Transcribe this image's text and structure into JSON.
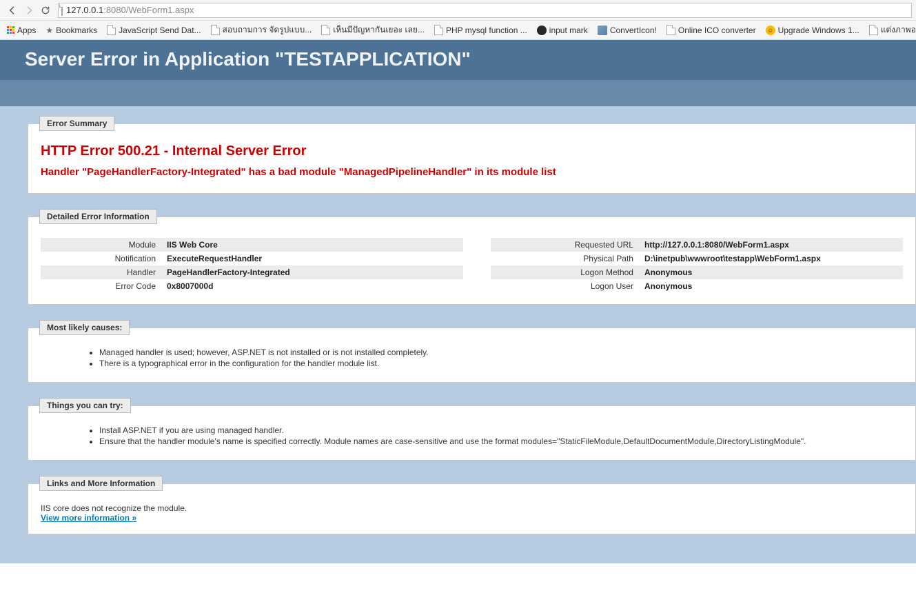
{
  "browser": {
    "url_host": "127.0.0.1",
    "url_rest": ":8080/WebForm1.aspx"
  },
  "bookmarks": {
    "apps": "Apps",
    "items": [
      {
        "label": "Bookmarks",
        "icon": "star"
      },
      {
        "label": "JavaScript Send Dat...",
        "icon": "page"
      },
      {
        "label": "สอบถามการ จัดรูปแบบ...",
        "icon": "page"
      },
      {
        "label": "เห็นมีปัญหากันเยอะ เลย...",
        "icon": "page"
      },
      {
        "label": "PHP mysql function ...",
        "icon": "page"
      },
      {
        "label": "input mark",
        "icon": "github"
      },
      {
        "label": "ConvertIcon!",
        "icon": "converticon"
      },
      {
        "label": "Online ICO converter",
        "icon": "page"
      },
      {
        "label": "Upgrade Windows 1...",
        "icon": "upgrade"
      },
      {
        "label": "แต่งภาพออน",
        "icon": "page"
      }
    ]
  },
  "header": {
    "title": "Server Error in Application \"TESTAPPLICATION\""
  },
  "summary": {
    "legend": "Error Summary",
    "title": "HTTP Error 500.21 - Internal Server Error",
    "subtitle": "Handler \"PageHandlerFactory-Integrated\" has a bad module \"ManagedPipelineHandler\" in its module list"
  },
  "detail": {
    "legend": "Detailed Error Information",
    "left_rows": [
      {
        "label": "Module",
        "value": "IIS Web Core"
      },
      {
        "label": "Notification",
        "value": "ExecuteRequestHandler"
      },
      {
        "label": "Handler",
        "value": "PageHandlerFactory-Integrated"
      },
      {
        "label": "Error Code",
        "value": "0x8007000d"
      }
    ],
    "right_rows": [
      {
        "label": "Requested URL",
        "value": "http://127.0.0.1:8080/WebForm1.aspx"
      },
      {
        "label": "Physical Path",
        "value": "D:\\inetpub\\wwwroot\\testapp\\WebForm1.aspx"
      },
      {
        "label": "Logon Method",
        "value": "Anonymous"
      },
      {
        "label": "Logon User",
        "value": "Anonymous"
      }
    ]
  },
  "causes": {
    "legend": "Most likely causes:",
    "items": [
      "Managed handler is used; however, ASP.NET is not installed or is not installed completely.",
      "There is a typographical error in the configuration for the handler module list."
    ]
  },
  "tryit": {
    "legend": "Things you can try:",
    "items": [
      "Install ASP.NET if you are using managed handler.",
      "Ensure that the handler module's name is specified correctly. Module names are case-sensitive and use the format modules=\"StaticFileModule,DefaultDocumentModule,DirectoryListingModule\"."
    ]
  },
  "links": {
    "legend": "Links and More Information",
    "text": "IIS core does not recognize the module.",
    "more": "View more information »"
  }
}
